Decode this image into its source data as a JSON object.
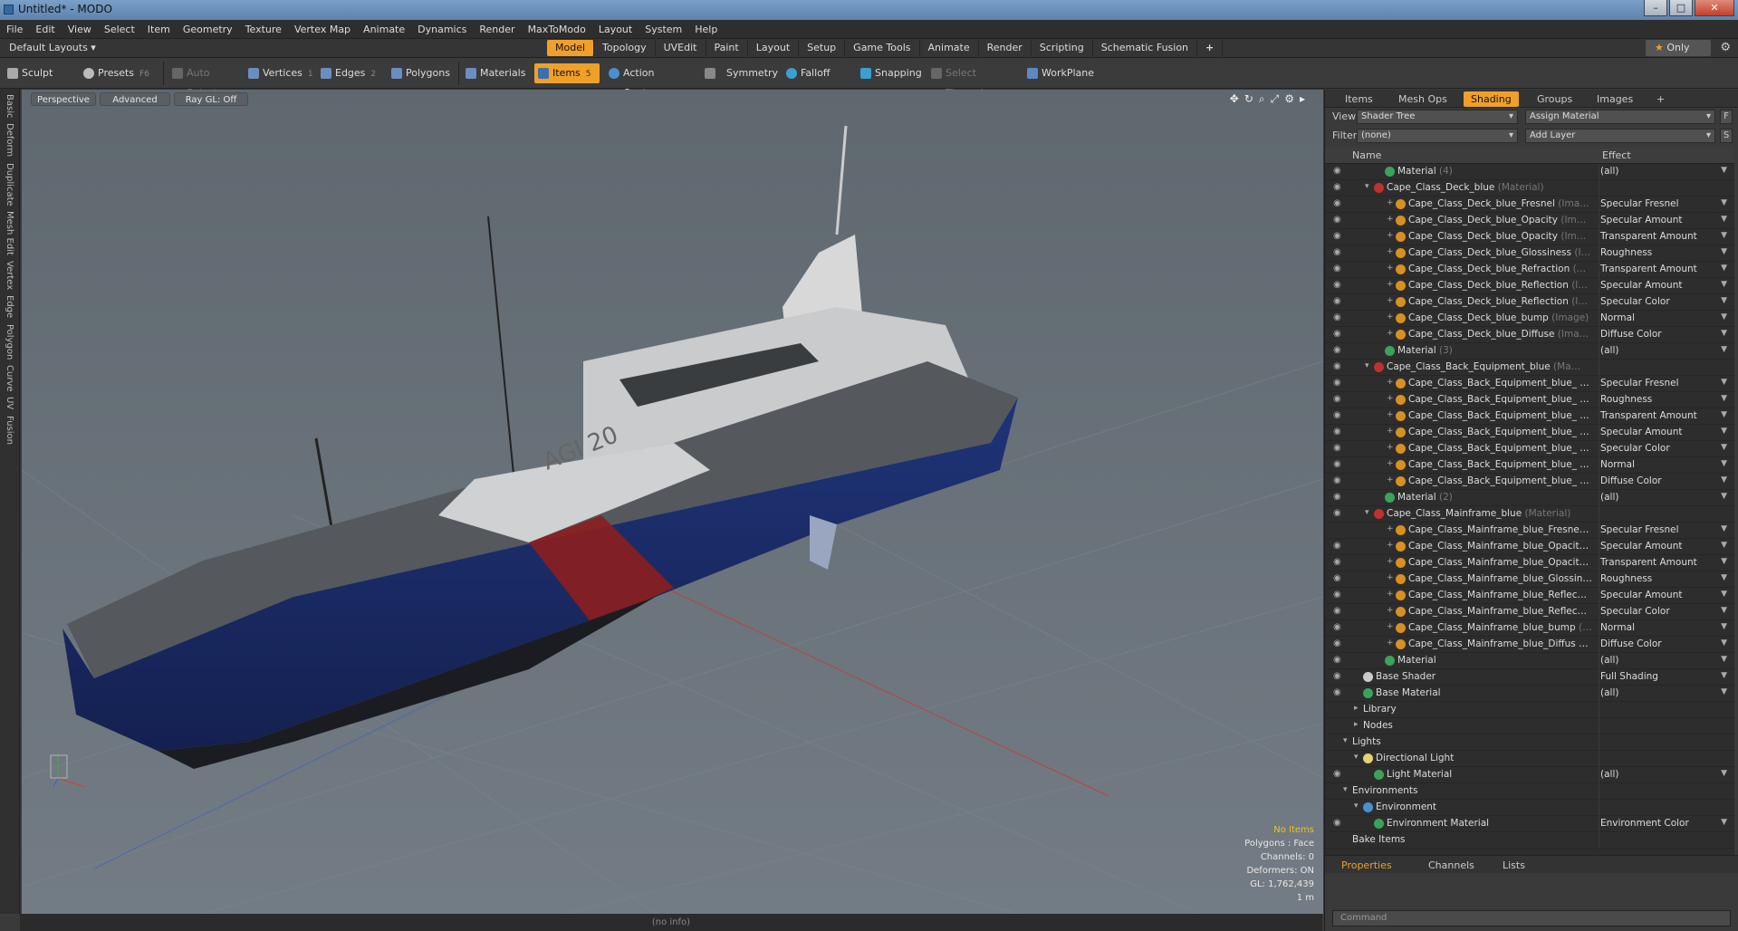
{
  "window": {
    "title": "Untitled* - MODO",
    "min": "–",
    "max": "□",
    "close": "✕"
  },
  "menu": [
    "File",
    "Edit",
    "View",
    "Select",
    "Item",
    "Geometry",
    "Texture",
    "Vertex Map",
    "Animate",
    "Dynamics",
    "Render",
    "MaxToModo",
    "Layout",
    "System",
    "Help"
  ],
  "layout": {
    "default": "Default Layouts ▾",
    "tabs": [
      "Model",
      "Topology",
      "UVEdit",
      "Paint",
      "Layout",
      "Setup",
      "Game Tools",
      "Animate",
      "Render",
      "Scripting",
      "Schematic Fusion"
    ],
    "active": "Model",
    "plus": "+",
    "only": "Only",
    "star": "★"
  },
  "toolbar": {
    "sculpt": "Sculpt",
    "presets": "Presets",
    "presets_key": "F6",
    "auto_select": "Auto Select",
    "vertices": "Vertices",
    "vertices_key": "1",
    "edges": "Edges",
    "edges_key": "2",
    "polygons": "Polygons",
    "materials": "Materials",
    "items": "Items",
    "items_key": "5",
    "action_center": "Action Center",
    "symmetry": "Symmetry",
    "falloff": "Falloff",
    "snapping": "Snapping",
    "select_through": "Select Through",
    "workplane": "WorkPlane"
  },
  "left_tabs": [
    "Basic",
    "Deform",
    "Duplicate",
    "Mesh Edit",
    "Vertex",
    "Edge",
    "Polygon",
    "Curve",
    "UV",
    "Fusion"
  ],
  "viewport": {
    "perspective": "Perspective",
    "advanced": "Advanced",
    "raygl": "Ray GL: Off",
    "hull_text": "AGI 20",
    "info": {
      "items": "No Items",
      "polygons": "Polygons : Face",
      "channels": "Channels: 0",
      "deformers": "Deformers: ON",
      "gl": "GL: 1,762,439",
      "scale": "1 m"
    }
  },
  "status": "(no info)",
  "right_panel": {
    "tabs": [
      "Items",
      "Mesh Ops",
      "Shading",
      "Groups",
      "Images"
    ],
    "active_tab": "Shading",
    "plus": "+",
    "view_label": "View",
    "view_value": "Shader Tree",
    "assign": "Assign Material",
    "filter_label": "Filter",
    "filter_value": "(none)",
    "add_layer": "Add Layer",
    "btn_f": "F",
    "btn_s": "S",
    "col_name": "Name",
    "col_effect": "Effect",
    "rows": [
      {
        "name": "Material",
        "suffix": "(4)",
        "effect": "(all)",
        "indent": 3,
        "icon": "#3aa35a",
        "eye": true,
        "exp": ""
      },
      {
        "name": "Cape_Class_Deck_blue",
        "suffix": "(Material)",
        "effect": "",
        "indent": 2,
        "icon": "#c03030",
        "eye": true,
        "exp": "▾"
      },
      {
        "name": "Cape_Class_Deck_blue_Fresnel",
        "suffix": "(Ima…",
        "effect": "Specular Fresnel",
        "indent": 4,
        "icon": "#d89020",
        "eye": true,
        "exp": "+"
      },
      {
        "name": "Cape_Class_Deck_blue_Opacity",
        "suffix": "(Im…",
        "effect": "Specular Amount",
        "indent": 4,
        "icon": "#d89020",
        "eye": true,
        "exp": "+"
      },
      {
        "name": "Cape_Class_Deck_blue_Opacity",
        "suffix": "(Im…",
        "effect": "Transparent Amount",
        "indent": 4,
        "icon": "#d89020",
        "eye": true,
        "exp": "+"
      },
      {
        "name": "Cape_Class_Deck_blue_Glossiness",
        "suffix": "(I…",
        "effect": "Roughness",
        "indent": 4,
        "icon": "#d89020",
        "eye": true,
        "exp": "+"
      },
      {
        "name": "Cape_Class_Deck_blue_Refraction",
        "suffix": "(…",
        "effect": "Transparent Amount",
        "indent": 4,
        "icon": "#d89020",
        "eye": true,
        "exp": "+"
      },
      {
        "name": "Cape_Class_Deck_blue_Reflection",
        "suffix": "(I…",
        "effect": "Specular Amount",
        "indent": 4,
        "icon": "#d89020",
        "eye": true,
        "exp": "+"
      },
      {
        "name": "Cape_Class_Deck_blue_Reflection",
        "suffix": "(I…",
        "effect": "Specular Color",
        "indent": 4,
        "icon": "#d89020",
        "eye": true,
        "exp": "+"
      },
      {
        "name": "Cape_Class_Deck_blue_bump",
        "suffix": "(Image)",
        "effect": "Normal",
        "indent": 4,
        "icon": "#d89020",
        "eye": true,
        "exp": "+"
      },
      {
        "name": "Cape_Class_Deck_blue_Diffuse",
        "suffix": "(Ima…",
        "effect": "Diffuse Color",
        "indent": 4,
        "icon": "#d89020",
        "eye": true,
        "exp": "+"
      },
      {
        "name": "Material",
        "suffix": "(3)",
        "effect": "(all)",
        "indent": 3,
        "icon": "#3aa35a",
        "eye": true,
        "exp": ""
      },
      {
        "name": "Cape_Class_Back_Equipment_blue",
        "suffix": "(Ma…",
        "effect": "",
        "indent": 2,
        "icon": "#c03030",
        "eye": true,
        "exp": "▾"
      },
      {
        "name": "Cape_Class_Back_Equipment_blue_ …",
        "suffix": "",
        "effect": "Specular Fresnel",
        "indent": 4,
        "icon": "#d89020",
        "eye": true,
        "exp": "+"
      },
      {
        "name": "Cape_Class_Back_Equipment_blue_ …",
        "suffix": "",
        "effect": "Roughness",
        "indent": 4,
        "icon": "#d89020",
        "eye": true,
        "exp": "+"
      },
      {
        "name": "Cape_Class_Back_Equipment_blue_ …",
        "suffix": "",
        "effect": "Transparent Amount",
        "indent": 4,
        "icon": "#d89020",
        "eye": true,
        "exp": "+"
      },
      {
        "name": "Cape_Class_Back_Equipment_blue_ …",
        "suffix": "",
        "effect": "Specular Amount",
        "indent": 4,
        "icon": "#d89020",
        "eye": true,
        "exp": "+"
      },
      {
        "name": "Cape_Class_Back_Equipment_blue_ …",
        "suffix": "",
        "effect": "Specular Color",
        "indent": 4,
        "icon": "#d89020",
        "eye": true,
        "exp": "+"
      },
      {
        "name": "Cape_Class_Back_Equipment_blue_ …",
        "suffix": "",
        "effect": "Normal",
        "indent": 4,
        "icon": "#d89020",
        "eye": true,
        "exp": "+"
      },
      {
        "name": "Cape_Class_Back_Equipment_blue_ …",
        "suffix": "",
        "effect": "Diffuse Color",
        "indent": 4,
        "icon": "#d89020",
        "eye": true,
        "exp": "+"
      },
      {
        "name": "Material",
        "suffix": "(2)",
        "effect": "(all)",
        "indent": 3,
        "icon": "#3aa35a",
        "eye": true,
        "exp": ""
      },
      {
        "name": "Cape_Class_Mainframe_blue",
        "suffix": "(Material)",
        "effect": "",
        "indent": 2,
        "icon": "#c03030",
        "eye": true,
        "exp": "▾"
      },
      {
        "name": "Cape_Class_Mainframe_blue_Fresne…",
        "suffix": "",
        "effect": "Specular Fresnel",
        "indent": 4,
        "icon": "#d89020",
        "eye": false,
        "exp": "+"
      },
      {
        "name": "Cape_Class_Mainframe_blue_Opacit…",
        "suffix": "",
        "effect": "Specular Amount",
        "indent": 4,
        "icon": "#d89020",
        "eye": true,
        "exp": "+"
      },
      {
        "name": "Cape_Class_Mainframe_blue_Opacit…",
        "suffix": "",
        "effect": "Transparent Amount",
        "indent": 4,
        "icon": "#d89020",
        "eye": true,
        "exp": "+"
      },
      {
        "name": "Cape_Class_Mainframe_blue_Glossin…",
        "suffix": "",
        "effect": "Roughness",
        "indent": 4,
        "icon": "#d89020",
        "eye": true,
        "exp": "+"
      },
      {
        "name": "Cape_Class_Mainframe_blue_Reflec…",
        "suffix": "",
        "effect": "Specular Amount",
        "indent": 4,
        "icon": "#d89020",
        "eye": true,
        "exp": "+"
      },
      {
        "name": "Cape_Class_Mainframe_blue_Reflec…",
        "suffix": "",
        "effect": "Specular Color",
        "indent": 4,
        "icon": "#d89020",
        "eye": true,
        "exp": "+"
      },
      {
        "name": "Cape_Class_Mainframe_blue_bump",
        "suffix": "(…",
        "effect": "Normal",
        "indent": 4,
        "icon": "#d89020",
        "eye": true,
        "exp": "+"
      },
      {
        "name": "Cape_Class_Mainframe_blue_Diffus …",
        "suffix": "",
        "effect": "Diffuse Color",
        "indent": 4,
        "icon": "#d89020",
        "eye": true,
        "exp": "+"
      },
      {
        "name": "Material",
        "suffix": "",
        "effect": "(all)",
        "indent": 3,
        "icon": "#3aa35a",
        "eye": true,
        "exp": ""
      },
      {
        "name": "Base Shader",
        "suffix": "",
        "effect": "Full Shading",
        "indent": 1,
        "icon": "#cccccc",
        "eye": true,
        "exp": ""
      },
      {
        "name": "Base Material",
        "suffix": "",
        "effect": "(all)",
        "indent": 1,
        "icon": "#3aa35a",
        "eye": true,
        "exp": ""
      },
      {
        "name": "Library",
        "suffix": "",
        "effect": "",
        "indent": 1,
        "icon": "",
        "eye": false,
        "exp": "▸"
      },
      {
        "name": "Nodes",
        "suffix": "",
        "effect": "",
        "indent": 1,
        "icon": "",
        "eye": false,
        "exp": "▸"
      },
      {
        "name": "Lights",
        "suffix": "",
        "effect": "",
        "indent": 0,
        "icon": "",
        "eye": false,
        "exp": "▾"
      },
      {
        "name": "Directional Light",
        "suffix": "",
        "effect": "",
        "indent": 1,
        "icon": "#e8d070",
        "eye": false,
        "exp": "▾"
      },
      {
        "name": "Light Material",
        "suffix": "",
        "effect": "(all)",
        "indent": 2,
        "icon": "#3aa35a",
        "eye": true,
        "exp": ""
      },
      {
        "name": "Environments",
        "suffix": "",
        "effect": "",
        "indent": 0,
        "icon": "",
        "eye": false,
        "exp": "▾"
      },
      {
        "name": "Environment",
        "suffix": "",
        "effect": "",
        "indent": 1,
        "icon": "#4a90d0",
        "eye": false,
        "exp": "▾"
      },
      {
        "name": "Environment Material",
        "suffix": "",
        "effect": "Environment Color",
        "indent": 2,
        "icon": "#3aa35a",
        "eye": true,
        "exp": ""
      },
      {
        "name": "Bake Items",
        "suffix": "",
        "effect": "",
        "indent": 0,
        "icon": "",
        "eye": false,
        "exp": ""
      }
    ],
    "bottom_tabs": [
      "Properties",
      "Channels",
      "Lists"
    ],
    "bottom_active": "Properties",
    "command": "Command"
  },
  "colors": {
    "accent": "#f0a028",
    "hull_blue": "#1a2c6a",
    "hull_red": "#8c1e1e",
    "grid": "#7d868e"
  }
}
